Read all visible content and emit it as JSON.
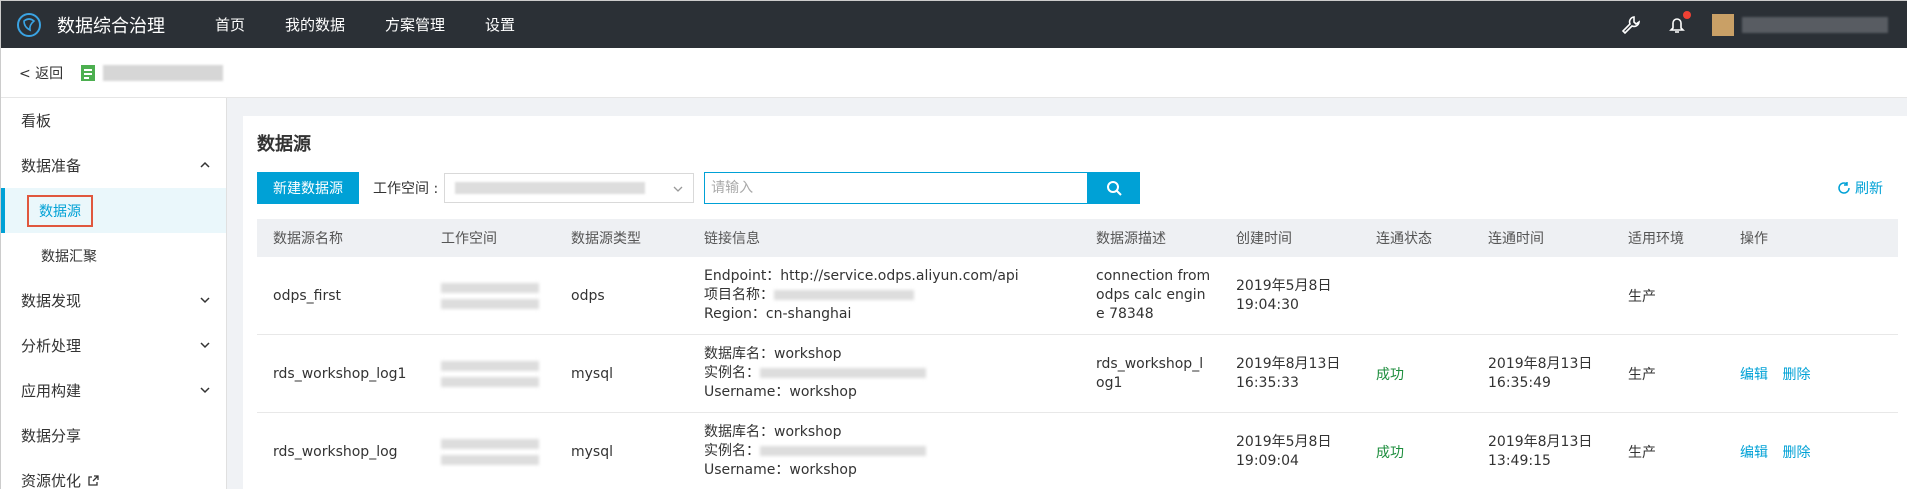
{
  "header": {
    "logo_icon": "logo-swirl-icon",
    "app_title": "数据综合治理",
    "nav": [
      "首页",
      "我的数据",
      "方案管理",
      "设置"
    ],
    "tools_icon": "wrench-icon",
    "bell_icon": "bell-icon"
  },
  "crumb": {
    "back_label": "< 返回"
  },
  "sidebar": {
    "items": [
      {
        "label": "看板"
      },
      {
        "label": "数据准备"
      },
      {
        "label": "数据源"
      },
      {
        "label": "数据汇聚"
      },
      {
        "label": "数据发现"
      },
      {
        "label": "分析处理"
      },
      {
        "label": "应用构建"
      },
      {
        "label": "数据分享"
      },
      {
        "label": "资源优化"
      }
    ]
  },
  "main": {
    "title": "数据源",
    "new_button": "新建数据源",
    "workspace_label": "工作空间 :",
    "search_placeholder": "请输入",
    "refresh_label": "刷新",
    "columns": [
      "数据源名称",
      "工作空间",
      "数据源类型",
      "链接信息",
      "数据源描述",
      "创建时间",
      "连通状态",
      "连通时间",
      "适用环境",
      "操作"
    ],
    "rows": [
      {
        "name": "odps_first",
        "type": "odps",
        "link": [
          "Endpoint：http://service.odps.aliyun.com/api",
          "项目名称：",
          "Region：cn-shanghai"
        ],
        "desc": [
          "connection from",
          "odps calc engin",
          "e 78348"
        ],
        "created": [
          "2019年5月8日",
          "19:04:30"
        ],
        "status": "",
        "conn_time": [
          "",
          ""
        ],
        "env": "生产",
        "ops": [
          "",
          ""
        ]
      },
      {
        "name": "rds_workshop_log1",
        "type": "mysql",
        "link": [
          "数据库名：workshop",
          "实例名：",
          "Username：workshop"
        ],
        "desc": [
          "rds_workshop_l",
          "og1"
        ],
        "created": [
          "2019年8月13日",
          "16:35:33"
        ],
        "status": "成功",
        "conn_time": [
          "2019年8月13日",
          "16:35:49"
        ],
        "env": "生产",
        "ops": [
          "编辑",
          "删除"
        ]
      },
      {
        "name": "rds_workshop_log",
        "type": "mysql",
        "link": [
          "数据库名：workshop",
          "实例名：",
          "Username：workshop"
        ],
        "desc": [],
        "created": [
          "2019年5月8日",
          "19:09:04"
        ],
        "status": "成功",
        "conn_time": [
          "2019年8月13日",
          "13:49:15"
        ],
        "env": "生产",
        "ops": [
          "编辑",
          "删除"
        ]
      }
    ]
  },
  "colors": {
    "accent": "#00a1d6",
    "topbar": "#2b3036",
    "success": "#1e8e3e",
    "highlight_border": "#e0573e"
  }
}
